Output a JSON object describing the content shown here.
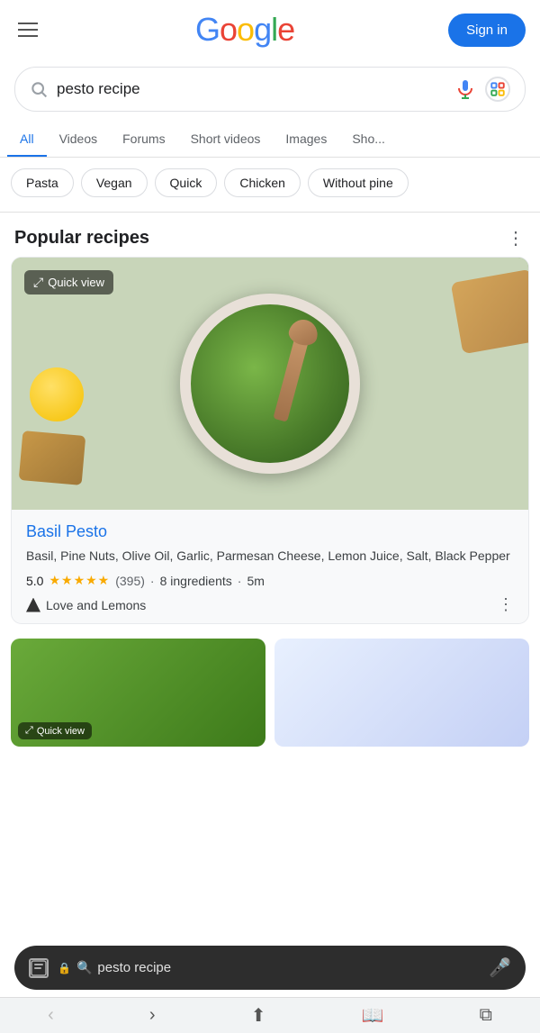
{
  "header": {
    "menu_label": "Menu",
    "logo": {
      "g1": "G",
      "o1": "o",
      "o2": "o",
      "g2": "g",
      "l": "l",
      "e": "e"
    },
    "sign_in_label": "Sign in"
  },
  "search": {
    "query": "pesto recipe",
    "placeholder": "Search"
  },
  "tabs": [
    {
      "label": "All",
      "active": true
    },
    {
      "label": "Videos",
      "active": false
    },
    {
      "label": "Forums",
      "active": false
    },
    {
      "label": "Short videos",
      "active": false
    },
    {
      "label": "Images",
      "active": false
    },
    {
      "label": "Sho...",
      "active": false
    }
  ],
  "filter_chips": [
    {
      "label": "Pasta"
    },
    {
      "label": "Vegan"
    },
    {
      "label": "Quick"
    },
    {
      "label": "Chicken"
    },
    {
      "label": "Without pine"
    }
  ],
  "popular_recipes": {
    "section_title": "Popular recipes",
    "recipe": {
      "title": "Basil Pesto",
      "ingredients": "Basil, Pine Nuts, Olive Oil, Garlic, Parmesan Cheese, Lemon Juice, Salt, Black Pepper",
      "rating": "5.0",
      "review_count": "(395)",
      "ingredient_count": "8 ingredients",
      "time": "5m",
      "source": "Love and Lemons",
      "quick_view_label": "Quick view"
    }
  },
  "bottom_bar": {
    "search_text": "pesto recipe",
    "lock_icon": "🔒",
    "search_icon": "🔍",
    "mic_icon": "🎤"
  },
  "browser_nav": {
    "back": "‹",
    "forward": "›",
    "share": "⬆",
    "bookmarks": "📖",
    "tabs": "⧉"
  }
}
